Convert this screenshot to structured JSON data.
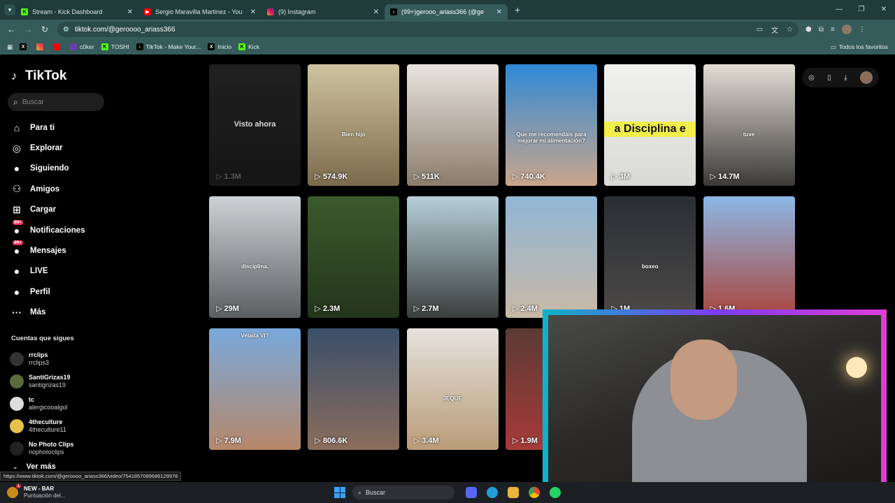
{
  "browser": {
    "tabs": [
      {
        "title": "Stream - Kick Dashboard",
        "active": false,
        "favicon": "kick-icon"
      },
      {
        "title": "Sergio Maravilla Martinez - You",
        "active": false,
        "favicon": "youtube-icon"
      },
      {
        "title": "(9) Instagram",
        "active": false,
        "favicon": "instagram-icon"
      },
      {
        "title": "(99+)gerooo_ariass366 (@ge",
        "active": true,
        "favicon": "tiktok-icon"
      }
    ],
    "url": "tiktok.com/@geroooo_ariass366",
    "bookmarks": [
      "",
      "",
      "",
      "c0ker",
      "TOSHI",
      "TikTok - Make Your...",
      "Inicio",
      "Kick"
    ],
    "bookmarks_all": "Todos los favoritos"
  },
  "tiktok": {
    "logo": "TikTok",
    "search_placeholder": "Buscar",
    "menu": [
      {
        "label": "Para ti",
        "icon": "home-icon"
      },
      {
        "label": "Explorar",
        "icon": "compass-icon"
      },
      {
        "label": "Siguiendo",
        "icon": "following-avatar-icon"
      },
      {
        "label": "Amigos",
        "icon": "friends-icon"
      },
      {
        "label": "Cargar",
        "icon": "upload-icon"
      },
      {
        "label": "Notificaciones",
        "icon": "bell-icon",
        "badge": "99+"
      },
      {
        "label": "Mensajes",
        "icon": "message-icon",
        "badge": "99+"
      },
      {
        "label": "LIVE",
        "icon": "live-icon"
      },
      {
        "label": "Perfil",
        "icon": "profile-icon"
      },
      {
        "label": "Más",
        "icon": "more-icon"
      }
    ],
    "following_header": "Cuentas que sigues",
    "following": [
      {
        "name": "rrclips",
        "handle": "rrclips3",
        "color": "#333"
      },
      {
        "name": "SantiGrizas19",
        "handle": "santigrizas19",
        "color": "#5a6a3a"
      },
      {
        "name": "tc",
        "handle": "alergicooalgol",
        "color": "#ddd"
      },
      {
        "name": "4theculture",
        "handle": "4theculture11",
        "color": "#e6c24a"
      },
      {
        "name": "No Photo Clips",
        "handle": "nophotoclips",
        "color": "#222"
      }
    ],
    "ver_mas": "Ver más",
    "videos": [
      {
        "views": "1.3M",
        "caption": "",
        "watching": "Visto ahora",
        "bg": "linear-gradient(#262626,#1a1a1a)"
      },
      {
        "views": "574.9K",
        "caption": "Bien hijo",
        "bg": "linear-gradient(#cfc3a0,#7b6a4c)"
      },
      {
        "views": "511K",
        "caption": "",
        "bg": "linear-gradient(#e8e4de,#8b7c6c)"
      },
      {
        "views": "740.4K",
        "caption": "Que me recomendáis para mejorar mi alimentación?",
        "bg": "linear-gradient(#2f89d8,#caa58a)"
      },
      {
        "views": "3M",
        "caption": "",
        "bigcaption": "a Disciplina e",
        "bg": "linear-gradient(#f1f1ef,#d9d9d6)"
      },
      {
        "views": "14.7M",
        "caption": "tuve",
        "bg": "linear-gradient(#e2ded6,#3c3a36)"
      },
      {
        "views": "29M",
        "caption": "disciplina.",
        "bg": "linear-gradient(#cfd2d4,#5c5f61)"
      },
      {
        "views": "2.3M",
        "caption": "",
        "bg": "linear-gradient(#3c5a2c,#24351c)"
      },
      {
        "views": "2.7M",
        "caption": "",
        "bg": "linear-gradient(#b6cfd9,#3a3f3d)"
      },
      {
        "views": "2.4M",
        "caption": "",
        "bg": "linear-gradient(#8fb6d6,#c9b9a6)"
      },
      {
        "views": "1M",
        "caption": "boxeo",
        "bg": "linear-gradient(#2a2e33,#4d4a48)"
      },
      {
        "views": "1.6M",
        "caption": "",
        "bg": "linear-gradient(#8cb8e6,#a9453c)"
      },
      {
        "views": "7.9M",
        "caption": "Velada VI?",
        "bg": "linear-gradient(#79a9dc,#b6876a)"
      },
      {
        "views": "806.6K",
        "caption": "",
        "bg": "linear-gradient(#3a4f6a,#8a6d5c)"
      },
      {
        "views": "3.4M",
        "caption": "JEQUE",
        "bg": "linear-gradient(#e5e2dc,#b99c78)"
      },
      {
        "views": "1.9M",
        "caption": "",
        "bg": "linear-gradient(#5a3a34,#a83a3a)"
      }
    ]
  },
  "status_url": "https://www.tiktok.com/@geroooo_ariass366/video/7541857089686129976",
  "taskbar": {
    "notif_badge": "1",
    "app_title": "NEW - BAR",
    "app_sub": "Puntuación del...",
    "search": "Buscar"
  }
}
